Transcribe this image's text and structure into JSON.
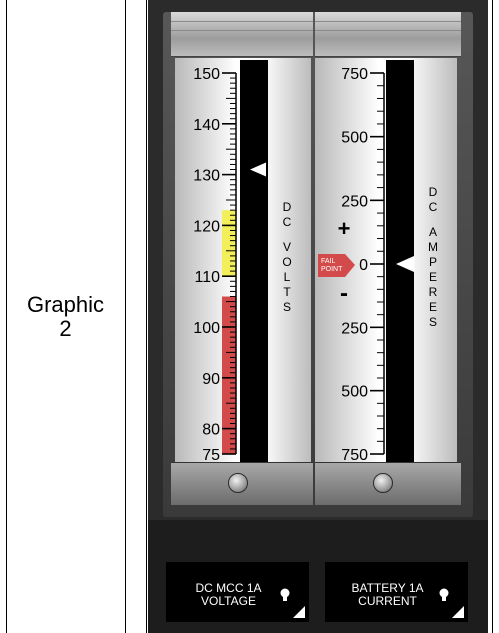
{
  "row_label": "Graphic\n2",
  "gauges": {
    "volts": {
      "label_letters": [
        "D",
        "C",
        "",
        "V",
        "O",
        "L",
        "T",
        "S"
      ],
      "ticks": [
        "150",
        "140",
        "130",
        "120",
        "110",
        "100",
        "90",
        "80",
        "75"
      ],
      "min": 75,
      "max": 150,
      "pointer_value": 131,
      "yellow_band": [
        110,
        123
      ],
      "red_band": [
        75,
        106
      ]
    },
    "amperes": {
      "label_letters": [
        "D",
        "C",
        "",
        "A",
        "M",
        "P",
        "E",
        "R",
        "E",
        "S"
      ],
      "ticks": [
        "750",
        "500",
        "250",
        "0",
        "250",
        "500",
        "750"
      ],
      "plus": "+",
      "minus": "-",
      "fail_point": "FAIL\nPOINT",
      "pointer_value": 0
    }
  },
  "buttons": [
    {
      "label": "DC MCC 1A\nVOLTAGE"
    },
    {
      "label": "BATTERY 1A\nCURRENT"
    }
  ],
  "colors": {
    "panel": "#2b2b2b",
    "yellow": "#f3ef5a",
    "red": "#d24a4a"
  }
}
